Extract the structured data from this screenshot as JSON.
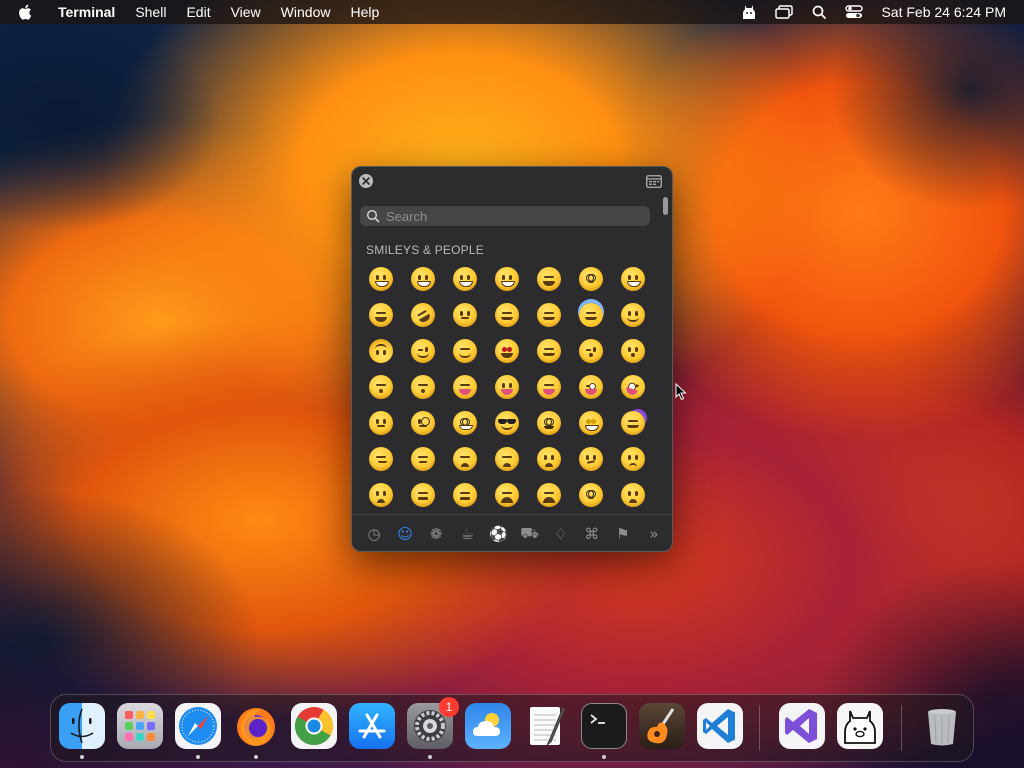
{
  "menubar": {
    "apple_icon": "apple-logo-icon",
    "app_name": "Terminal",
    "menus": [
      "Shell",
      "Edit",
      "View",
      "Window",
      "Help"
    ],
    "status_icons": [
      "ollama-icon",
      "screen-mirroring-icon",
      "search-icon",
      "control-center-icon"
    ],
    "clock": "Sat Feb 24  6:24 PM"
  },
  "emoji_picker": {
    "search_placeholder": "Search",
    "section_title": "SMILEYS & PEOPLE",
    "close_icon": "close-icon",
    "expand_icon": "character-viewer-icon",
    "categories": [
      {
        "name": "frequently-used",
        "icon": "clock-icon",
        "glyph": "◷",
        "active": false
      },
      {
        "name": "smileys-people",
        "icon": "smiley-icon",
        "glyph": "☺",
        "active": true
      },
      {
        "name": "animals-nature",
        "icon": "bear-icon",
        "glyph": "❁",
        "active": false
      },
      {
        "name": "food-drink",
        "icon": "cake-icon",
        "glyph": "☕",
        "active": false
      },
      {
        "name": "activity",
        "icon": "ball-icon",
        "glyph": "⚽",
        "active": false
      },
      {
        "name": "travel-places",
        "icon": "car-icon",
        "glyph": "⛟",
        "active": false
      },
      {
        "name": "objects",
        "icon": "lightbulb-icon",
        "glyph": "♢",
        "active": false
      },
      {
        "name": "symbols",
        "icon": "symbols-icon",
        "glyph": "⌘",
        "active": false
      },
      {
        "name": "flags",
        "icon": "flag-icon",
        "glyph": "⚑",
        "active": false
      },
      {
        "name": "more",
        "icon": "chevron-double-right-icon",
        "glyph": "»",
        "active": false
      }
    ]
  },
  "dock": {
    "apps": [
      {
        "name": "Finder",
        "icon": "finder-icon",
        "running": true
      },
      {
        "name": "Launchpad",
        "icon": "launchpad-icon",
        "running": false
      },
      {
        "name": "Safari",
        "icon": "safari-icon",
        "running": true
      },
      {
        "name": "Firefox",
        "icon": "firefox-icon",
        "running": true
      },
      {
        "name": "Google Chrome",
        "icon": "chrome-icon",
        "running": false
      },
      {
        "name": "App Store",
        "icon": "app-store-icon",
        "running": false
      },
      {
        "name": "System Settings",
        "icon": "settings-icon",
        "running": true,
        "badge": "1"
      },
      {
        "name": "Weather",
        "icon": "weather-icon",
        "running": false
      },
      {
        "name": "TextEdit",
        "icon": "textedit-icon",
        "running": false
      },
      {
        "name": "Terminal",
        "icon": "terminal-icon",
        "running": true
      },
      {
        "name": "GarageBand",
        "icon": "garageband-icon",
        "running": false
      },
      {
        "name": "Visual Studio Code",
        "icon": "vscode-icon",
        "running": false
      },
      {
        "name": "Visual Studio",
        "icon": "visual-studio-icon",
        "running": false
      },
      {
        "name": "Ollama",
        "icon": "ollama-icon",
        "running": false
      },
      {
        "name": "Trash",
        "icon": "trash-icon",
        "running": false
      }
    ]
  },
  "colors": {
    "accent": "#2f8bff",
    "badge": "#ff3b30"
  }
}
